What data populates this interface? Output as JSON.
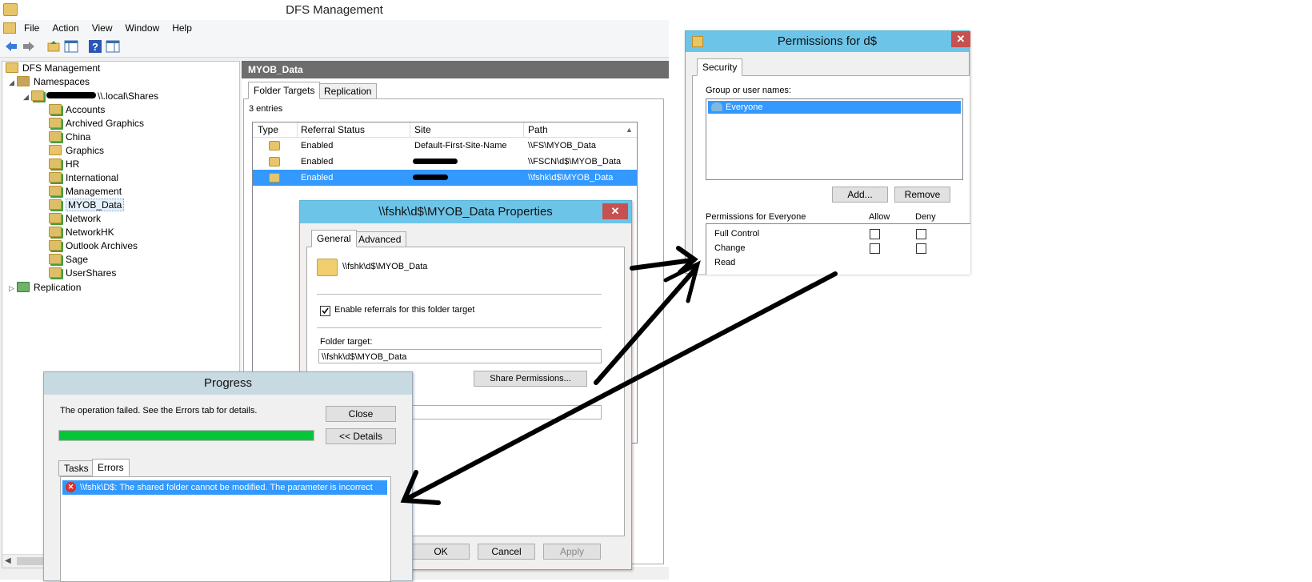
{
  "main_window": {
    "title": "DFS Management",
    "menu": [
      "File",
      "Action",
      "View",
      "Window",
      "Help"
    ]
  },
  "tree": {
    "root": "DFS Management",
    "namespaces": "Namespaces",
    "namespace_node": "\\\\.local\\Shares",
    "folders": [
      "Accounts",
      "Archived Graphics",
      "China",
      "Graphics",
      "HR",
      "International",
      "Management",
      "MYOB_Data",
      "Network",
      "NetworkHK",
      "Outlook Archives",
      "Sage",
      "UserShares"
    ],
    "selected_folder": "MYOB_Data",
    "replication": "Replication"
  },
  "right_pane": {
    "header": "MYOB_Data",
    "tabs": [
      "Folder Targets",
      "Replication"
    ],
    "entries_count": "3 entries",
    "columns": [
      "Type",
      "Referral Status",
      "Site",
      "Path"
    ],
    "rows": [
      {
        "status": "Enabled",
        "site": "Default-First-Site-Name",
        "path": "\\\\FS\\MYOB_Data"
      },
      {
        "status": "Enabled",
        "site": "",
        "path": "\\\\FSCN\\d$\\MYOB_Data"
      },
      {
        "status": "Enabled",
        "site": "",
        "path": "\\\\fshk\\d$\\MYOB_Data"
      }
    ]
  },
  "properties_dialog": {
    "title": "\\\\fshk\\d$\\MYOB_Data Properties",
    "close": "✕",
    "tabs": [
      "General",
      "Advanced"
    ],
    "folder_path": "\\\\fshk\\d$\\MYOB_Data",
    "enable_referrals_label": "Enable referrals for this folder target",
    "folder_target_label": "Folder target:",
    "folder_target_value": "\\\\fshk\\d$\\MYOB_Data",
    "share_permissions_button": "Share Permissions...",
    "ok": "OK",
    "cancel": "Cancel",
    "apply": "Apply"
  },
  "progress_dialog": {
    "title": "Progress",
    "message": "The operation failed.  See the Errors tab for details.",
    "close_button": "Close",
    "details_button": "<< Details",
    "progress_value": 1.0,
    "tabs": [
      "Tasks",
      "Errors"
    ],
    "error_text": "\\\\fshk\\D$: The shared folder cannot be modified. The parameter is incorrect"
  },
  "permissions_dialog": {
    "title": "Permissions for d$",
    "close": "✕",
    "tab": "Security",
    "group_label": "Group or user names:",
    "users": [
      "Everyone"
    ],
    "add_button": "Add...",
    "remove_button": "Remove",
    "permissions_for_label": "Permissions for Everyone",
    "allow_label": "Allow",
    "deny_label": "Deny",
    "permissions": [
      "Full Control",
      "Change",
      "Read"
    ]
  },
  "colors": {
    "selection": "#3399ff",
    "title_bar": "#6cc4e8",
    "progress_fill": "#06c53a",
    "close_red": "#c75050"
  }
}
